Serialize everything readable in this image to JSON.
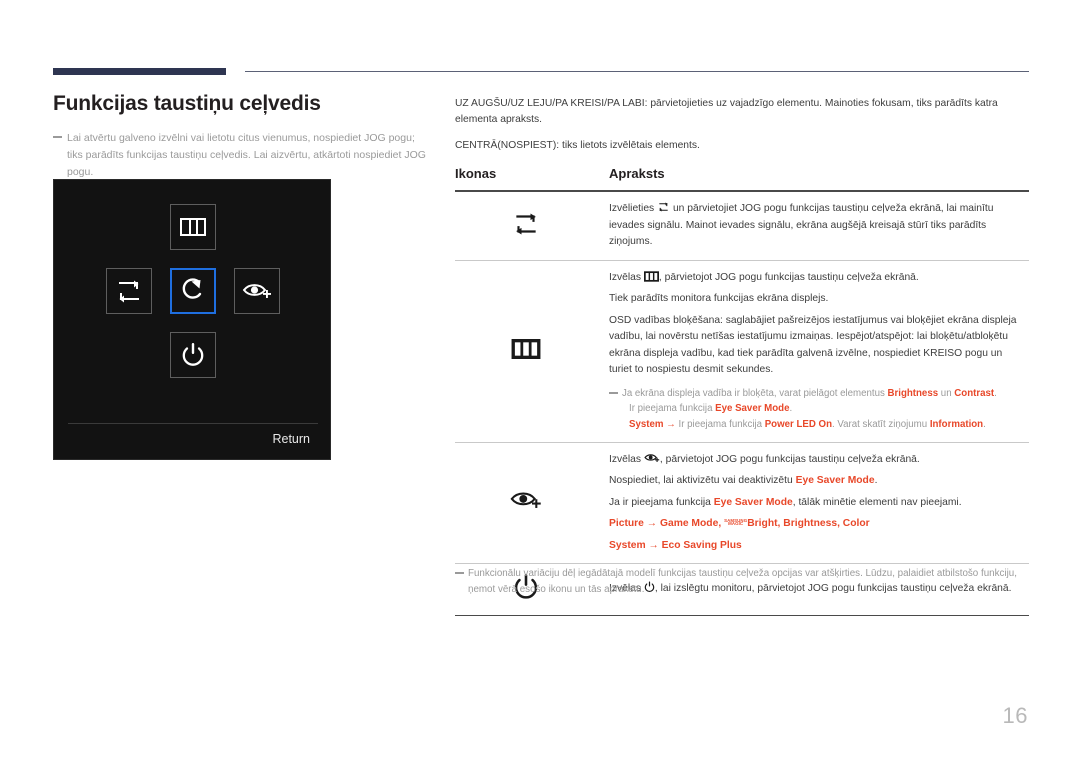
{
  "page": {
    "number": "16",
    "title": "Funkcijas taustiņu ceļvedis",
    "intro_note": "Lai atvērtu galveno izvēlni vai lietotu citus vienumus, nospiediet JOG pogu; tiks parādīts funkcijas taustiņu ceļvedis. Lai aizvērtu, atkārtoti nospiediet JOG pogu."
  },
  "colors": {
    "rule_navy": "#2e3551",
    "accent_red": "#e8482a",
    "osd_background": "#121212",
    "osd_highlight": "#1f6fe0",
    "body_text": "#3d3d3d",
    "muted_text": "#9a9a9a",
    "page_number": "#b9b9b9"
  },
  "osd": {
    "return_label": "Return",
    "keys": [
      {
        "position": "up",
        "icon": "menu-icon",
        "selected": false
      },
      {
        "position": "left",
        "icon": "source-swap-icon",
        "selected": false
      },
      {
        "position": "center",
        "icon": "return-arrow-icon",
        "selected": true
      },
      {
        "position": "right",
        "icon": "eye-saver-icon",
        "selected": false
      },
      {
        "position": "down",
        "icon": "power-icon",
        "selected": false
      }
    ]
  },
  "intro": {
    "paragraph1": "UZ AUGŠU/UZ LEJU/PA KREISI/PA LABI: pārvietojieties uz vajadzīgo elementu. Mainoties fokusam, tiks parādīts katra elementa apraksts.",
    "paragraph2": "CENTRĀ(NOSPIEST): tiks lietots izvēlētais elements."
  },
  "table": {
    "headers": {
      "icon": "Ikonas",
      "description": "Apraksts"
    },
    "rows": [
      {
        "icon": "source-swap-icon",
        "lines": [
          {
            "segments": [
              {
                "text": "Izvēlieties ",
                "style": "plain"
              },
              {
                "text": "[source-swap-icon]",
                "style": "inline-icon"
              },
              {
                "text": " un pārvietojiet JOG pogu funkcijas taustiņu ceļveža ekrānā, lai mainītu ievades signālu. Mainot ievades signālu, ekrāna augšējā kreisajā stūrī tiks parādīts ziņojums.",
                "style": "plain"
              }
            ]
          }
        ],
        "note": null
      },
      {
        "icon": "menu-icon",
        "lines": [
          {
            "segments": [
              {
                "text": "Izvēlas ",
                "style": "plain"
              },
              {
                "text": "[menu-icon]",
                "style": "inline-icon"
              },
              {
                "text": ", pārvietojot JOG pogu funkcijas taustiņu ceļveža ekrānā.",
                "style": "plain"
              }
            ]
          },
          {
            "segments": [
              {
                "text": "Tiek parādīts monitora funkcijas ekrāna displejs.",
                "style": "plain"
              }
            ]
          },
          {
            "segments": [
              {
                "text": "OSD vadības bloķēšana: saglabājiet pašreizējos iestatījumus vai bloķējiet ekrāna displeja vadību, lai novērstu netīšas iestatījumu izmaiņas. Iespējot/atspējot: lai bloķētu/atbloķētu ekrāna displeja vadību, kad tiek parādīta galvenā izvēlne, nospiediet KREISO pogu un turiet to nospiestu desmit sekundes.",
                "style": "plain"
              }
            ]
          }
        ],
        "note": {
          "line1": [
            {
              "text": "Ja ekrāna displeja vadība ir bloķēta, varat pielāgot elementus ",
              "style": "muted"
            },
            {
              "text": "Brightness",
              "style": "red"
            },
            {
              "text": " un ",
              "style": "muted"
            },
            {
              "text": "Contrast",
              "style": "red"
            },
            {
              "text": ".",
              "style": "muted"
            }
          ],
          "line2": [
            {
              "text": "Ir pieejama funkcija ",
              "style": "muted"
            },
            {
              "text": "Eye Saver Mode",
              "style": "red"
            },
            {
              "text": ".",
              "style": "muted"
            }
          ],
          "line3": [
            {
              "text": "System",
              "style": "red"
            },
            {
              "text": " → ",
              "style": "red"
            },
            {
              "text": "Ir pieejama funkcija ",
              "style": "muted"
            },
            {
              "text": "Power LED On",
              "style": "red"
            },
            {
              "text": ". Varat skatīt ziņojumu ",
              "style": "muted"
            },
            {
              "text": "Information",
              "style": "red"
            },
            {
              "text": ".",
              "style": "muted"
            }
          ]
        }
      },
      {
        "icon": "eye-saver-icon",
        "lines": [
          {
            "segments": [
              {
                "text": "Izvēlas ",
                "style": "plain"
              },
              {
                "text": "[eye-saver-icon]",
                "style": "inline-icon"
              },
              {
                "text": ", pārvietojot JOG pogu funkcijas taustiņu ceļveža ekrānā.",
                "style": "plain"
              }
            ]
          },
          {
            "segments": [
              {
                "text": "Nospiediet, lai aktivizētu vai deaktivizētu ",
                "style": "plain"
              },
              {
                "text": "Eye Saver Mode",
                "style": "red"
              },
              {
                "text": ".",
                "style": "plain"
              }
            ]
          },
          {
            "segments": [
              {
                "text": "Ja ir pieejama funkcija ",
                "style": "plain"
              },
              {
                "text": "Eye Saver Mode",
                "style": "red"
              },
              {
                "text": ", tālāk minētie elementi nav pieejami.",
                "style": "plain"
              }
            ]
          },
          {
            "segments": [
              {
                "text": "Picture",
                "style": "red"
              },
              {
                "text": " → ",
                "style": "red"
              },
              {
                "text": "Game Mode",
                "style": "red"
              },
              {
                "text": ", ",
                "style": "red"
              },
              {
                "text": "[samsung-magic-bright]",
                "style": "magic"
              },
              {
                "text": ", ",
                "style": "red"
              },
              {
                "text": "Brightness",
                "style": "red"
              },
              {
                "text": ", ",
                "style": "red"
              },
              {
                "text": "Color",
                "style": "red"
              }
            ]
          },
          {
            "segments": [
              {
                "text": "System",
                "style": "red"
              },
              {
                "text": " → ",
                "style": "red"
              },
              {
                "text": "Eco Saving Plus",
                "style": "red"
              }
            ]
          }
        ],
        "note": null
      },
      {
        "icon": "power-icon",
        "lines": [
          {
            "segments": [
              {
                "text": "Izvēlas ",
                "style": "plain"
              },
              {
                "text": "[power-icon]",
                "style": "inline-icon"
              },
              {
                "text": ", lai izslēgtu monitoru, pārvietojot JOG pogu funkcijas taustiņu ceļveža ekrānā.",
                "style": "plain"
              }
            ]
          }
        ],
        "note": null
      }
    ]
  },
  "footnote": "Funkcionālu variāciju dēļ iegādātajā modelī funkcijas taustiņu ceļveža opcijas var atšķirties. Lūdzu, palaidiet atbilstošo funkciju, ņemot vērā esošo ikonu un tās aprakstu.",
  "magic_bright": {
    "top": "SAMSUNG",
    "bottom": "MAGIC",
    "suffix": "Bright"
  }
}
